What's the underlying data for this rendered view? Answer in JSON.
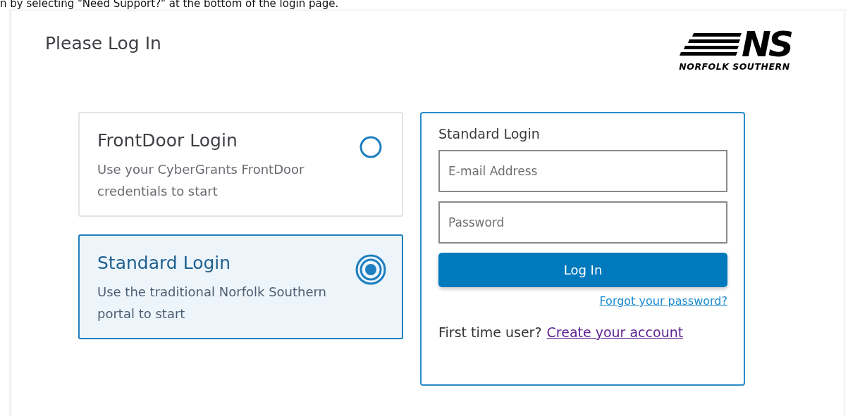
{
  "note": "n by selecting \"Need Support?\" at the bottom of the login page.",
  "heading": "Please Log In",
  "logo": {
    "mark": "NS",
    "name": "NORFOLK SOUTHERN"
  },
  "login_options": [
    {
      "title": "FrontDoor Login",
      "description": "Use your CyberGrants FrontDoor credentials to start",
      "selected": false
    },
    {
      "title": "Standard Login",
      "description": "Use the traditional Norfolk Southern portal to start",
      "selected": true
    }
  ],
  "login_form": {
    "title": "Standard Login",
    "email": {
      "placeholder": "E-mail Address"
    },
    "password": {
      "placeholder": "Password"
    },
    "submit": "Log In",
    "forgot_link": "Forgot your password?",
    "signup_prompt": "First time user?",
    "signup_link": "Create your account"
  }
}
